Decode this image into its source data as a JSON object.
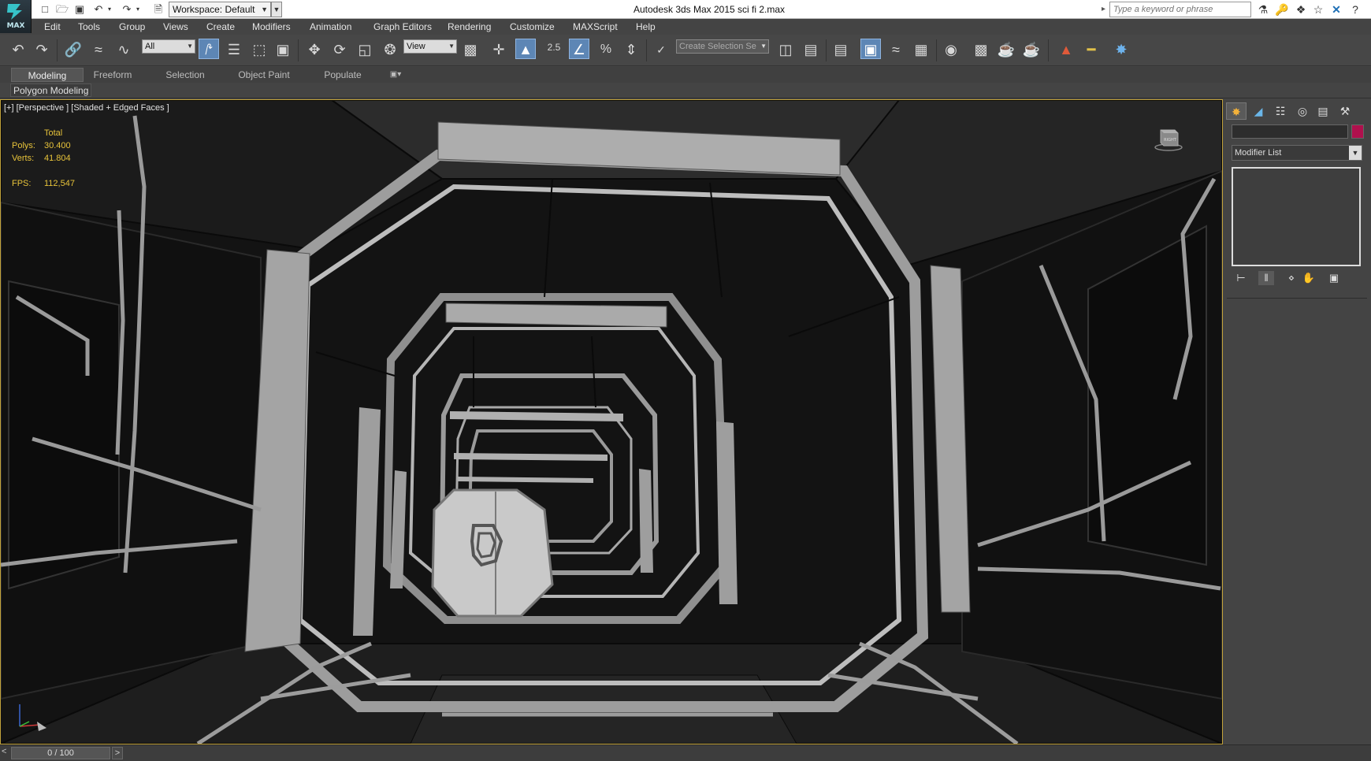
{
  "title_bar": {
    "app_title": "Autodesk 3ds Max  2015      sci fi 2.max",
    "logo_text": "MAX",
    "workspace_label": "Workspace: Default",
    "search_placeholder": "Type a keyword or phrase"
  },
  "menu": {
    "items": [
      "Edit",
      "Tools",
      "Group",
      "Views",
      "Create",
      "Modifiers",
      "Animation",
      "Graph Editors",
      "Rendering",
      "Customize",
      "MAXScript",
      "Help"
    ]
  },
  "toolbar": {
    "selection_filter": "All",
    "reference_coord": "View",
    "snap_angle_label": "2.5",
    "named_selection_placeholder": "Create Selection Se"
  },
  "ribbon": {
    "tabs": [
      "Modeling",
      "Freeform",
      "Selection",
      "Object Paint",
      "Populate"
    ],
    "active_tab": "Modeling",
    "panel_label": "Polygon Modeling"
  },
  "viewport": {
    "label": "[+] [Perspective ] [Shaded + Edged Faces ]",
    "stats": {
      "header": "Total",
      "polys_label": "Polys:",
      "polys_value": "30.400",
      "verts_label": "Verts:",
      "verts_value": "41.804",
      "fps_label": "FPS:",
      "fps_value": "112,547"
    },
    "viewcube_label": "RIGHT"
  },
  "command_panel": {
    "modifier_list_label": "Modifier List",
    "object_color": "#b0104d"
  },
  "timeline": {
    "frame_label": "0 / 100",
    "prev_label": "<",
    "next_label": ">"
  },
  "colors": {
    "viewport_border": "#c2a33b",
    "stats_text": "#e7c33a",
    "active_tool": "#5d86b5"
  }
}
